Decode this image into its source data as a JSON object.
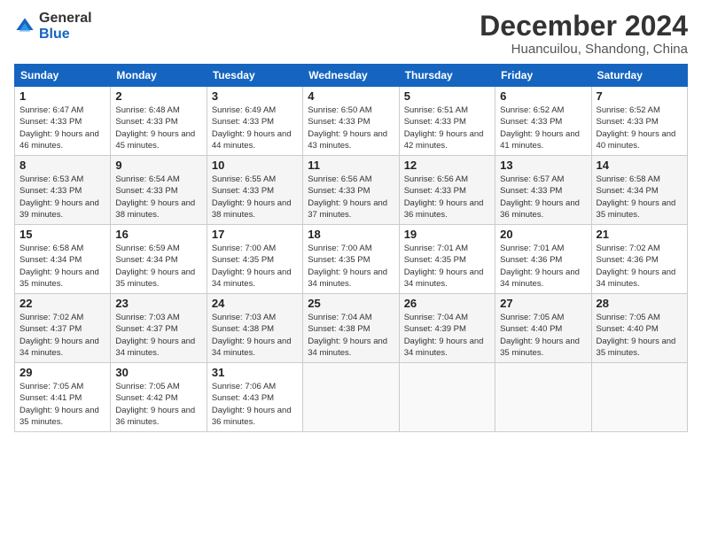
{
  "logo": {
    "general": "General",
    "blue": "Blue"
  },
  "title": "December 2024",
  "subtitle": "Huancuilou, Shandong, China",
  "weekdays": [
    "Sunday",
    "Monday",
    "Tuesday",
    "Wednesday",
    "Thursday",
    "Friday",
    "Saturday"
  ],
  "weeks": [
    [
      {
        "day": "1",
        "sunrise": "6:47 AM",
        "sunset": "4:33 PM",
        "daylight": "9 hours and 46 minutes."
      },
      {
        "day": "2",
        "sunrise": "6:48 AM",
        "sunset": "4:33 PM",
        "daylight": "9 hours and 45 minutes."
      },
      {
        "day": "3",
        "sunrise": "6:49 AM",
        "sunset": "4:33 PM",
        "daylight": "9 hours and 44 minutes."
      },
      {
        "day": "4",
        "sunrise": "6:50 AM",
        "sunset": "4:33 PM",
        "daylight": "9 hours and 43 minutes."
      },
      {
        "day": "5",
        "sunrise": "6:51 AM",
        "sunset": "4:33 PM",
        "daylight": "9 hours and 42 minutes."
      },
      {
        "day": "6",
        "sunrise": "6:52 AM",
        "sunset": "4:33 PM",
        "daylight": "9 hours and 41 minutes."
      },
      {
        "day": "7",
        "sunrise": "6:52 AM",
        "sunset": "4:33 PM",
        "daylight": "9 hours and 40 minutes."
      }
    ],
    [
      {
        "day": "8",
        "sunrise": "6:53 AM",
        "sunset": "4:33 PM",
        "daylight": "9 hours and 39 minutes."
      },
      {
        "day": "9",
        "sunrise": "6:54 AM",
        "sunset": "4:33 PM",
        "daylight": "9 hours and 38 minutes."
      },
      {
        "day": "10",
        "sunrise": "6:55 AM",
        "sunset": "4:33 PM",
        "daylight": "9 hours and 38 minutes."
      },
      {
        "day": "11",
        "sunrise": "6:56 AM",
        "sunset": "4:33 PM",
        "daylight": "9 hours and 37 minutes."
      },
      {
        "day": "12",
        "sunrise": "6:56 AM",
        "sunset": "4:33 PM",
        "daylight": "9 hours and 36 minutes."
      },
      {
        "day": "13",
        "sunrise": "6:57 AM",
        "sunset": "4:33 PM",
        "daylight": "9 hours and 36 minutes."
      },
      {
        "day": "14",
        "sunrise": "6:58 AM",
        "sunset": "4:34 PM",
        "daylight": "9 hours and 35 minutes."
      }
    ],
    [
      {
        "day": "15",
        "sunrise": "6:58 AM",
        "sunset": "4:34 PM",
        "daylight": "9 hours and 35 minutes."
      },
      {
        "day": "16",
        "sunrise": "6:59 AM",
        "sunset": "4:34 PM",
        "daylight": "9 hours and 35 minutes."
      },
      {
        "day": "17",
        "sunrise": "7:00 AM",
        "sunset": "4:35 PM",
        "daylight": "9 hours and 34 minutes."
      },
      {
        "day": "18",
        "sunrise": "7:00 AM",
        "sunset": "4:35 PM",
        "daylight": "9 hours and 34 minutes."
      },
      {
        "day": "19",
        "sunrise": "7:01 AM",
        "sunset": "4:35 PM",
        "daylight": "9 hours and 34 minutes."
      },
      {
        "day": "20",
        "sunrise": "7:01 AM",
        "sunset": "4:36 PM",
        "daylight": "9 hours and 34 minutes."
      },
      {
        "day": "21",
        "sunrise": "7:02 AM",
        "sunset": "4:36 PM",
        "daylight": "9 hours and 34 minutes."
      }
    ],
    [
      {
        "day": "22",
        "sunrise": "7:02 AM",
        "sunset": "4:37 PM",
        "daylight": "9 hours and 34 minutes."
      },
      {
        "day": "23",
        "sunrise": "7:03 AM",
        "sunset": "4:37 PM",
        "daylight": "9 hours and 34 minutes."
      },
      {
        "day": "24",
        "sunrise": "7:03 AM",
        "sunset": "4:38 PM",
        "daylight": "9 hours and 34 minutes."
      },
      {
        "day": "25",
        "sunrise": "7:04 AM",
        "sunset": "4:38 PM",
        "daylight": "9 hours and 34 minutes."
      },
      {
        "day": "26",
        "sunrise": "7:04 AM",
        "sunset": "4:39 PM",
        "daylight": "9 hours and 34 minutes."
      },
      {
        "day": "27",
        "sunrise": "7:05 AM",
        "sunset": "4:40 PM",
        "daylight": "9 hours and 35 minutes."
      },
      {
        "day": "28",
        "sunrise": "7:05 AM",
        "sunset": "4:40 PM",
        "daylight": "9 hours and 35 minutes."
      }
    ],
    [
      {
        "day": "29",
        "sunrise": "7:05 AM",
        "sunset": "4:41 PM",
        "daylight": "9 hours and 35 minutes."
      },
      {
        "day": "30",
        "sunrise": "7:05 AM",
        "sunset": "4:42 PM",
        "daylight": "9 hours and 36 minutes."
      },
      {
        "day": "31",
        "sunrise": "7:06 AM",
        "sunset": "4:43 PM",
        "daylight": "9 hours and 36 minutes."
      },
      null,
      null,
      null,
      null
    ]
  ]
}
